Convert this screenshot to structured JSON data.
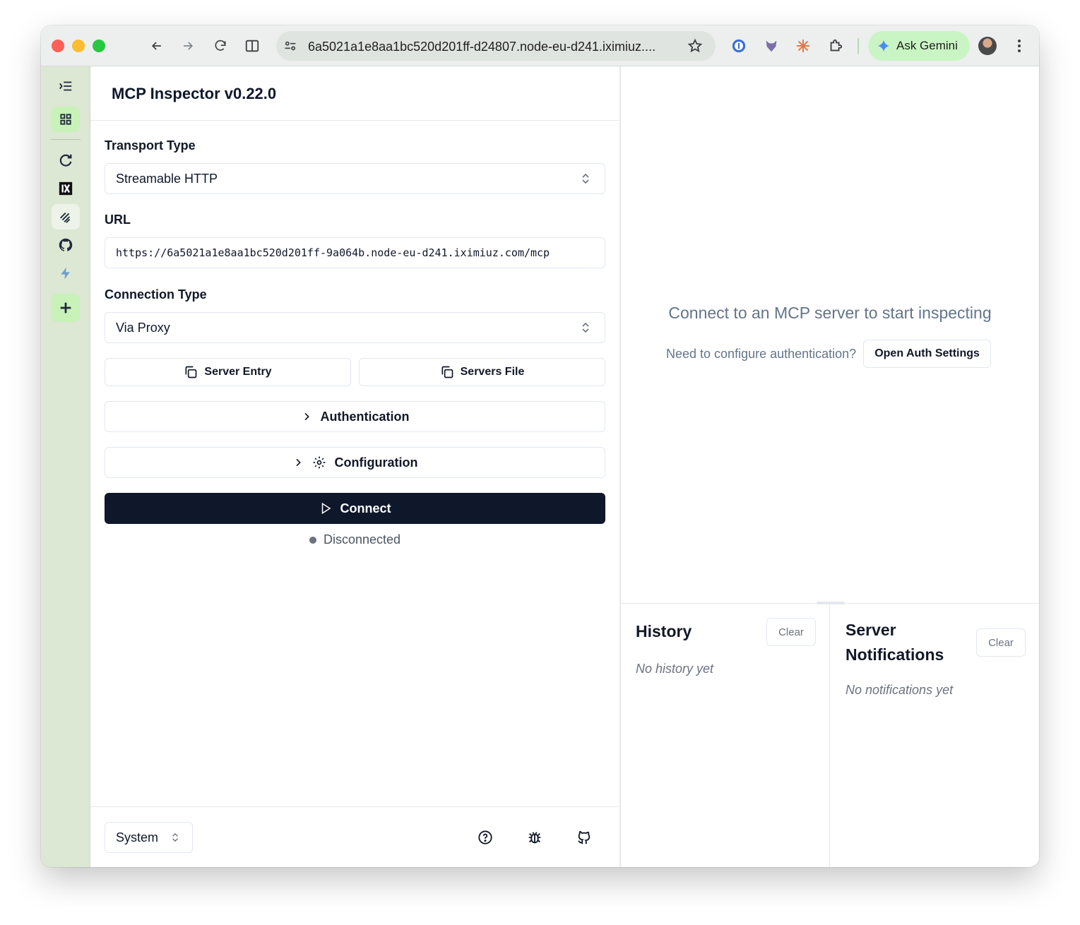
{
  "browser": {
    "url": "6a5021a1e8aa1bc520d201ff-d24807.node-eu-d241.iximiuz....",
    "gemini_label": "Ask Gemini"
  },
  "app": {
    "title": "MCP Inspector v0.22.0"
  },
  "form": {
    "transport_label": "Transport Type",
    "transport_value": "Streamable HTTP",
    "url_label": "URL",
    "url_value": "https://6a5021a1e8aa1bc520d201ff-9a064b.node-eu-d241.iximiuz.com/mcp",
    "connection_label": "Connection Type",
    "connection_value": "Via Proxy",
    "server_entry_label": "Server Entry",
    "servers_file_label": "Servers File",
    "authentication_label": "Authentication",
    "configuration_label": "Configuration",
    "connect_label": "Connect",
    "status_text": "Disconnected"
  },
  "footer": {
    "theme_value": "System"
  },
  "main": {
    "empty_message": "Connect to an MCP server to start inspecting",
    "auth_prompt": "Need to configure authentication?",
    "auth_button": "Open Auth Settings"
  },
  "history": {
    "title": "History",
    "clear_label": "Clear",
    "empty_text": "No history yet"
  },
  "notifications": {
    "title_line1": "Server",
    "title_line2": "Notifications",
    "clear_label": "Clear",
    "empty_text": "No notifications yet"
  },
  "colors": {
    "primary": "#0f172a",
    "rail_bg": "#dce7d4",
    "gemini_bg": "#c9f5c4"
  }
}
